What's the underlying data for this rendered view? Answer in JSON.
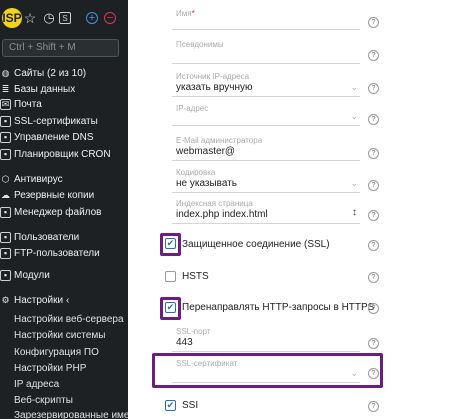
{
  "sidebar": {
    "logo": "ISP",
    "search_placeholder": "Ctrl + Shift + M",
    "items": [
      {
        "label": "Сайты (2 из 10)",
        "icon": "globe-icon"
      },
      {
        "label": "Базы данных",
        "icon": "database-icon"
      },
      {
        "label": "Почта",
        "icon": "mail-icon"
      },
      {
        "label": "SSL-сертификаты",
        "icon": "lock-icon"
      },
      {
        "label": "Управление DNS",
        "icon": "dns-icon"
      },
      {
        "label": "Планировщик CRON",
        "icon": "clock-icon"
      },
      {
        "label": "Антивирус",
        "icon": "shield-icon"
      },
      {
        "label": "Резервные копии",
        "icon": "cloud-icon"
      },
      {
        "label": "Менеджер файлов",
        "icon": "folder-icon"
      },
      {
        "label": "Пользователи",
        "icon": "user-icon"
      },
      {
        "label": "FTP-пользователи",
        "icon": "ftp-icon"
      },
      {
        "label": "Модули",
        "icon": "module-icon"
      },
      {
        "label": "Настройки",
        "icon": "settings-icon"
      }
    ],
    "sub_items": [
      "Настройки веб-сервера",
      "Настройки системы",
      "Конфигурация ПО",
      "Настройки PHP",
      "IP адреса",
      "Веб-скрипты",
      "Зарезервированные имена"
    ]
  },
  "form": {
    "name": {
      "label": "Имя",
      "value": ""
    },
    "aliases": {
      "label": "Псевдонимы",
      "value": ""
    },
    "ip_source": {
      "label": "Источник IP-адреса",
      "value": "указать вручную"
    },
    "ip": {
      "label": "IP-адрес",
      "value": ""
    },
    "admin_email": {
      "label": "E-Mail администратора",
      "value": "webmaster@"
    },
    "encoding": {
      "label": "Кодировка",
      "value": "не указывать"
    },
    "index_page": {
      "label": "Индексная страница",
      "value": "index.php index.html"
    },
    "ssl": {
      "label": "Защищенное соединение (SSL)",
      "checked": true
    },
    "hsts": {
      "label": "HSTS",
      "checked": false
    },
    "redirect_https": {
      "label": "Перенаправлять HTTP-запросы в HTTPS",
      "checked": true
    },
    "ssl_port": {
      "label": "SSL-порт",
      "value": "443"
    },
    "ssl_cert": {
      "label": "SSL-сертификат",
      "value": ""
    },
    "ssi": {
      "label": "SSI",
      "checked": true
    }
  },
  "colors": {
    "sidebar_bg": "#1d2123",
    "highlight": "#6b1e7f",
    "accent": "#2a6ebb"
  }
}
